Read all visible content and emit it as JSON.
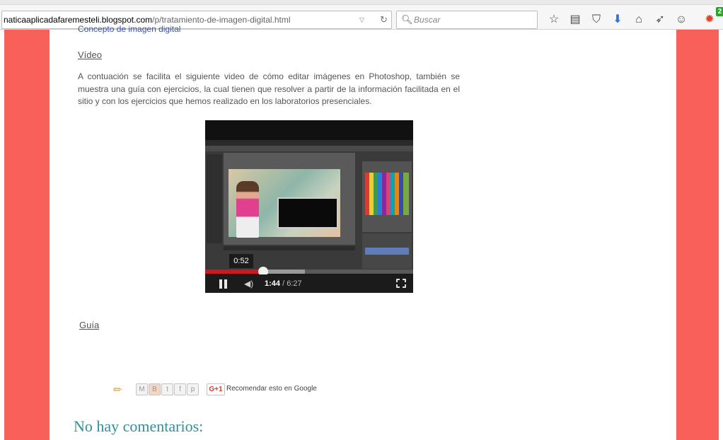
{
  "browser": {
    "url_host": "naticaaplicadafaremesteli.blogspot.com",
    "url_path": "/p/tratamiento-de-imagen-digital.html",
    "search_placeholder": "Buscar",
    "notification_count": "2"
  },
  "page": {
    "cut_link": "Concepto de imagen digital",
    "video_heading": "Vídeo",
    "paragraph": "A contuación se facilita el siguiente video de cómo editar imágenes en Photoshop, también se muestra una guía con ejercicios, la cual tienen que resolver a partir de la información facilitada en el sitio y con los  ejercicios que hemos realizado en los laboratorios presenciales.",
    "guide_heading": " Guía",
    "share_recommend": "Recomendar esto en Google",
    "gplus_label": "G+1",
    "comments_heading": "No hay comentarios:"
  },
  "video": {
    "tooltip_time": "0:52",
    "current_time": "1:44",
    "duration": " / 6:27",
    "played_fraction": 0.28,
    "buffered_fraction": 0.48
  },
  "share_buttons": [
    "M",
    "B",
    "t",
    "f",
    "p"
  ]
}
